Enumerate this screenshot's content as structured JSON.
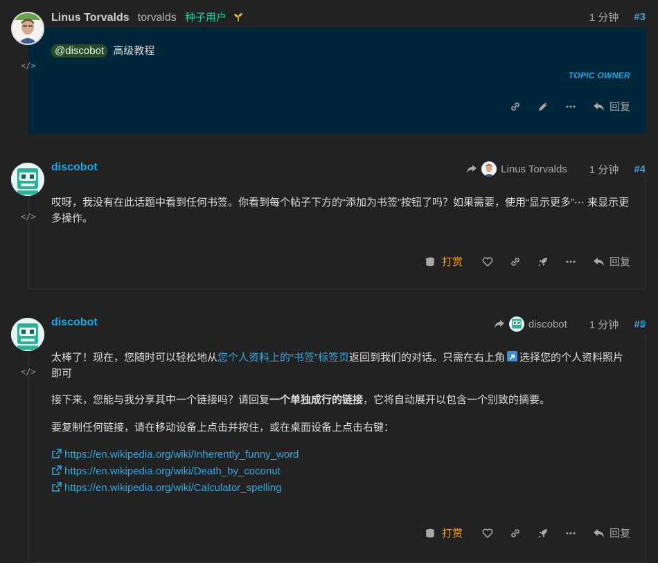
{
  "posts": [
    {
      "name": "Linus Torvalds",
      "username": "torvalds",
      "title": "种子用户",
      "time": "1 分钟",
      "number": "#3",
      "mention": "@discobot",
      "text": "高级教程",
      "owner_label": "TOPIC OWNER",
      "reply_label": "回复"
    },
    {
      "name": "discobot",
      "reply_to": "Linus Torvalds",
      "time": "1 分钟",
      "number": "#4",
      "text": "哎呀，我没有在此话题中看到任何书签。你看到每个帖子下方的“添加为书签”按钮了吗？如果需要，使用“显示更多”⋯ 来显示更多操作。",
      "tip_label": "打赏",
      "reply_label": "回复"
    },
    {
      "name": "discobot",
      "reply_to": "discobot",
      "time": "1 分钟",
      "number": "#5",
      "p1_a": "太棒了！现在，您随时可以轻松地从",
      "p1_link": "您个人资料上的“书签”标签页",
      "p1_b": "返回到我们的对话。只需在右上角",
      "p1_c": "选择您的个人资料照片即可",
      "p2_a": "接下来，您能与我分享其中一个链接吗？请回复",
      "p2_bold": "一个单独成行的链接",
      "p2_b": "，它将自动展开以包含一个别致的摘要。",
      "p3": "要复制任何链接，请在移动设备上点击并按住，或在桌面设备上点击右键：",
      "links": [
        "https://en.wikipedia.org/wiki/Inherently_funny_word",
        "https://en.wikipedia.org/wiki/Death_by_coconut",
        "https://en.wikipedia.org/wiki/Calculator_spelling"
      ],
      "tip_label": "打赏",
      "reply_label": "回复"
    }
  ],
  "colors": {
    "background": "#222222",
    "owner_post_bg": "#00263a",
    "accent": "#1aa8e8",
    "tip": "#f3a417",
    "title": "#1dd1a1"
  },
  "icons": [
    "code-icon",
    "link-icon",
    "pencil-icon",
    "ellipsis-icon",
    "reply-icon",
    "heart-icon",
    "rocket-icon",
    "coins-icon",
    "share-arrow-icon",
    "external-link-icon",
    "sprout-icon"
  ]
}
